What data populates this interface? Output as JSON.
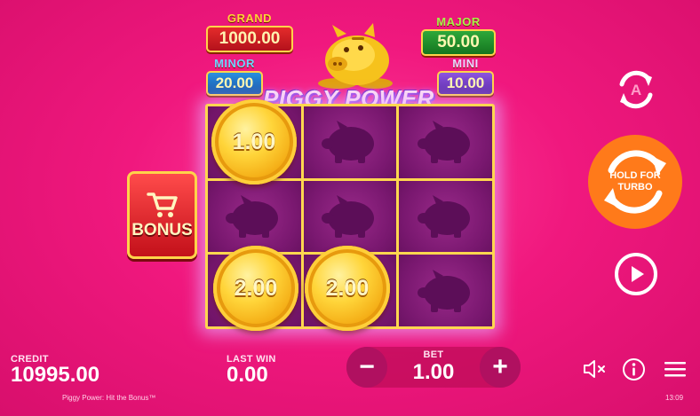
{
  "jackpots": {
    "grand": {
      "label": "GRAND",
      "value": "1000.00"
    },
    "major": {
      "label": "MAJOR",
      "value": "50.00"
    },
    "minor": {
      "label": "MINOR",
      "value": "20.00"
    },
    "mini": {
      "label": "MINI",
      "value": "10.00"
    }
  },
  "logo": {
    "title": "PIGGY POWER"
  },
  "coins": {
    "c1": "1.00",
    "c2": "2.00",
    "c3": "2.00"
  },
  "bonus": {
    "label": "BONUS"
  },
  "controls": {
    "turbo_label": "HOLD FOR TURBO",
    "auto_letter": "A"
  },
  "bottom": {
    "credit_label": "CREDIT",
    "credit_value": "10995.00",
    "last_win_label": "LAST WIN",
    "last_win_value": "0.00",
    "bet_label": "BET",
    "bet_value": "1.00",
    "minus": "−",
    "plus": "+"
  },
  "footer": {
    "game_name": "Piggy Power: Hit the Bonus™",
    "time": "13:09"
  },
  "colors": {
    "background": "#f0187e",
    "turbo": "#ff7a1a",
    "grid_border": "#ffd74f"
  }
}
